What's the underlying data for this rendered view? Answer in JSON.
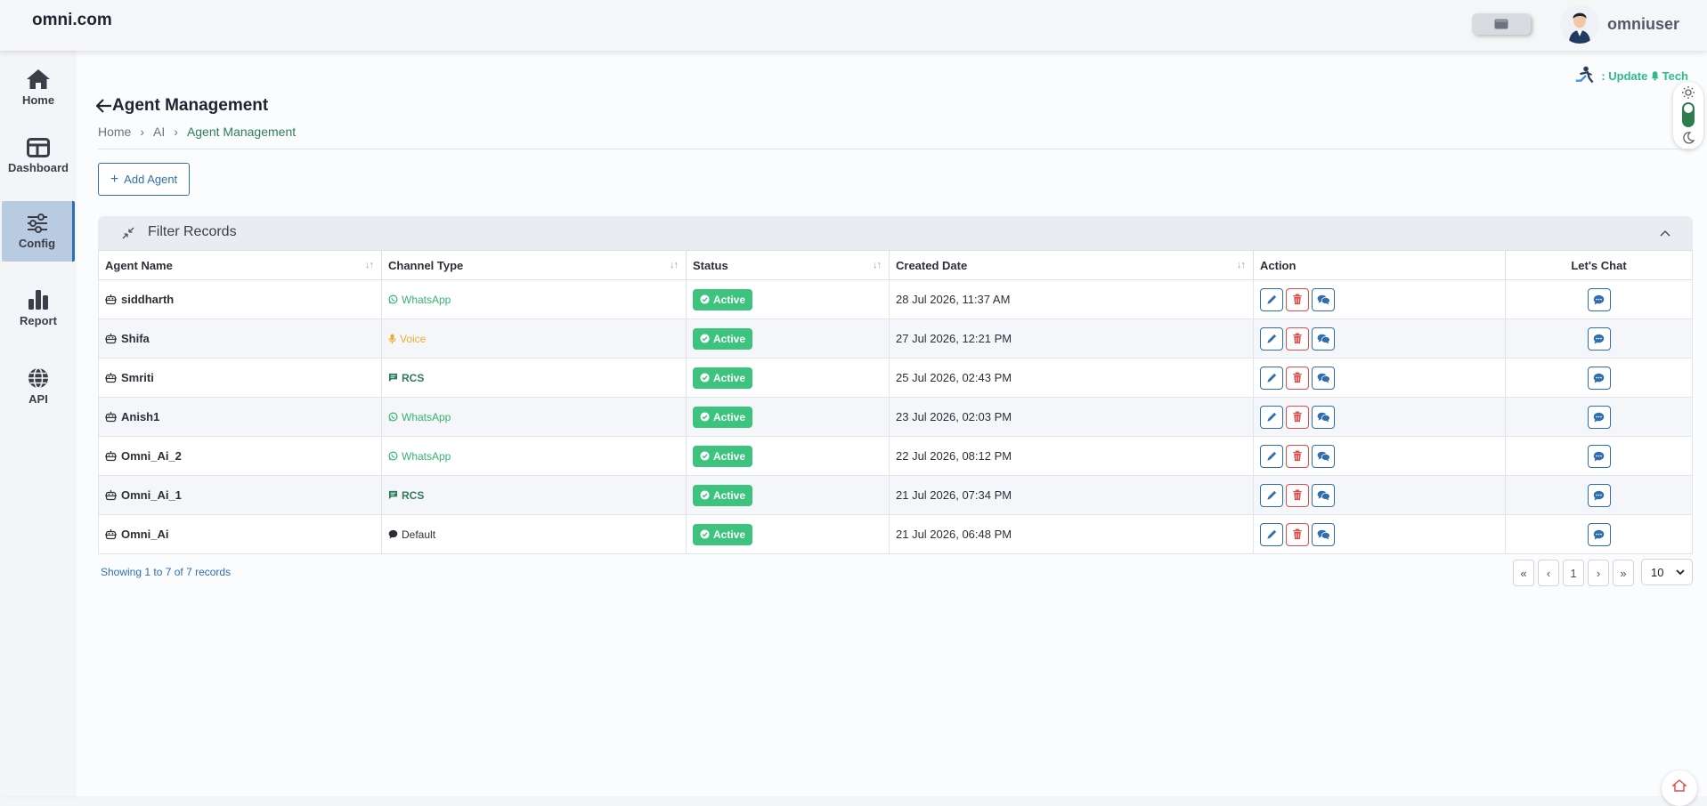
{
  "app": {
    "brand": "omni.com",
    "username": "omniuser"
  },
  "sidebar": {
    "items": [
      {
        "label": "Home",
        "icon": "home-icon"
      },
      {
        "label": "Dashboard",
        "icon": "dashboard-icon"
      },
      {
        "label": "Config",
        "icon": "sliders-icon",
        "active": true
      },
      {
        "label": "Report",
        "icon": "bar-chart-icon"
      },
      {
        "label": "API",
        "icon": "globe-icon"
      }
    ]
  },
  "banner": {
    "update_text": ": Update",
    "tech_text": "Tech"
  },
  "page": {
    "title": "Agent Management",
    "breadcrumb": [
      "Home",
      "AI",
      "Agent Management"
    ],
    "add_button": "Add Agent",
    "filter_label": "Filter Records"
  },
  "table": {
    "columns": [
      "Agent Name",
      "Channel Type",
      "Status",
      "Created Date",
      "Action",
      "Let's Chat"
    ],
    "rows": [
      {
        "name": "siddharth",
        "channel": "WhatsApp",
        "channel_kind": "whatsapp",
        "status": "Active",
        "created": "28 Jul 2026, 11:37 AM"
      },
      {
        "name": "Shifa",
        "channel": "Voice",
        "channel_kind": "voice",
        "status": "Active",
        "created": "27 Jul 2026, 12:21 PM"
      },
      {
        "name": "Smriti",
        "channel": "RCS",
        "channel_kind": "rcs",
        "status": "Active",
        "created": "25 Jul 2026, 02:43 PM"
      },
      {
        "name": "Anish1",
        "channel": "WhatsApp",
        "channel_kind": "whatsapp",
        "status": "Active",
        "created": "23 Jul 2026, 02:03 PM"
      },
      {
        "name": "Omni_Ai_2",
        "channel": "WhatsApp",
        "channel_kind": "whatsapp",
        "status": "Active",
        "created": "22 Jul 2026, 08:12 PM"
      },
      {
        "name": "Omni_Ai_1",
        "channel": "RCS",
        "channel_kind": "rcs",
        "status": "Active",
        "created": "21 Jul 2026, 07:34 PM"
      },
      {
        "name": "Omni_Ai",
        "channel": "Default",
        "channel_kind": "default",
        "status": "Active",
        "created": "21 Jul 2026, 06:48 PM"
      }
    ]
  },
  "footer": {
    "info": "Showing 1 to 7 of 7 records",
    "pager": {
      "first": "«",
      "prev": "‹",
      "page": "1",
      "next": "›",
      "last": "»"
    },
    "per_page": "10"
  },
  "colors": {
    "accent": "#2f6fb0",
    "active_status": "#3cc37e",
    "danger": "#e04b4b",
    "whatsapp": "#35b36c",
    "voice": "#e8b02a"
  }
}
